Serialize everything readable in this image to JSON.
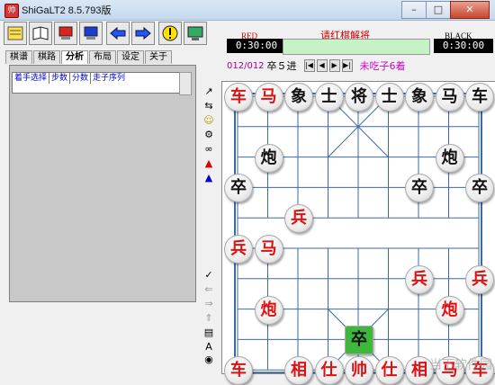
{
  "window": {
    "title": "ShiGaLT2 8.5.793版",
    "min": "–",
    "max": "□",
    "close": "✕"
  },
  "toolbar": {
    "buttons": [
      "notes-icon",
      "book-icon",
      "computer-red-icon",
      "computer-blue-icon",
      "back-arrow-icon",
      "forward-arrow-icon",
      "hint-icon",
      "monitor-icon"
    ]
  },
  "tabs": [
    {
      "label": "棋谱",
      "active": false
    },
    {
      "label": "棋路",
      "active": false
    },
    {
      "label": "分析",
      "active": true
    },
    {
      "label": "布局",
      "active": false
    },
    {
      "label": "设定",
      "active": false
    },
    {
      "label": "关于",
      "active": false
    }
  ],
  "analysis": {
    "columns": [
      "着手选择",
      "步数",
      "分数",
      "走子序列"
    ]
  },
  "clocks": {
    "red_label": "RED",
    "red_time": "0:30:00",
    "black_label": "BLACK",
    "black_time": "0:30:00",
    "status": "请红棋解将"
  },
  "movebar": {
    "count": "012/012",
    "move": "卒５进",
    "nav": [
      "|◀",
      "◀",
      "▶",
      "▶|"
    ],
    "info": "未吃子6着"
  },
  "board": {
    "pieces": [
      {
        "ch": "车",
        "color": "red",
        "c": 0,
        "r": 0
      },
      {
        "ch": "马",
        "color": "red",
        "c": 1,
        "r": 0
      },
      {
        "ch": "象",
        "color": "black",
        "c": 2,
        "r": 0
      },
      {
        "ch": "士",
        "color": "black",
        "c": 3,
        "r": 0
      },
      {
        "ch": "将",
        "color": "black",
        "c": 4,
        "r": 0
      },
      {
        "ch": "士",
        "color": "black",
        "c": 5,
        "r": 0
      },
      {
        "ch": "象",
        "color": "black",
        "c": 6,
        "r": 0
      },
      {
        "ch": "马",
        "color": "black",
        "c": 7,
        "r": 0
      },
      {
        "ch": "车",
        "color": "black",
        "c": 8,
        "r": 0
      },
      {
        "ch": "炮",
        "color": "black",
        "c": 1,
        "r": 2
      },
      {
        "ch": "炮",
        "color": "black",
        "c": 7,
        "r": 2
      },
      {
        "ch": "卒",
        "color": "black",
        "c": 0,
        "r": 3
      },
      {
        "ch": "卒",
        "color": "black",
        "c": 6,
        "r": 3
      },
      {
        "ch": "卒",
        "color": "black",
        "c": 8,
        "r": 3
      },
      {
        "ch": "兵",
        "color": "red",
        "c": 2,
        "r": 4
      },
      {
        "ch": "兵",
        "color": "red",
        "c": 0,
        "r": 5
      },
      {
        "ch": "马",
        "color": "red",
        "c": 1,
        "r": 5
      },
      {
        "ch": "兵",
        "color": "red",
        "c": 6,
        "r": 6
      },
      {
        "ch": "兵",
        "color": "red",
        "c": 8,
        "r": 6
      },
      {
        "ch": "炮",
        "color": "red",
        "c": 1,
        "r": 7
      },
      {
        "ch": "炮",
        "color": "red",
        "c": 7,
        "r": 7
      },
      {
        "ch": "卒",
        "color": "black",
        "c": 4,
        "r": 8,
        "selected": true
      },
      {
        "ch": "车",
        "color": "red",
        "c": 0,
        "r": 9
      },
      {
        "ch": "相",
        "color": "red",
        "c": 2,
        "r": 9
      },
      {
        "ch": "仕",
        "color": "red",
        "c": 3,
        "r": 9
      },
      {
        "ch": "帅",
        "color": "red",
        "c": 4,
        "r": 9
      },
      {
        "ch": "仕",
        "color": "red",
        "c": 5,
        "r": 9
      },
      {
        "ch": "相",
        "color": "red",
        "c": 6,
        "r": 9
      },
      {
        "ch": "马",
        "color": "red",
        "c": 7,
        "r": 9
      },
      {
        "ch": "车",
        "color": "red",
        "c": 8,
        "r": 9
      }
    ]
  },
  "watermark": "当下软件园"
}
